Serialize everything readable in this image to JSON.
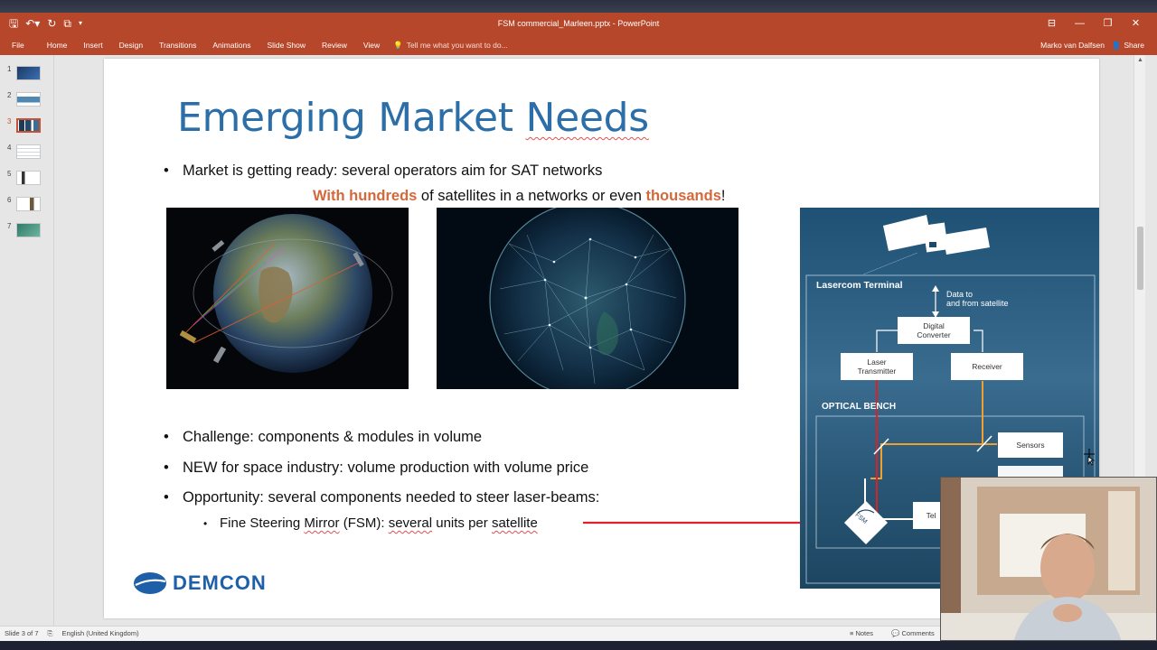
{
  "window": {
    "title": "FSM commercial_Marleen.pptx - PowerPoint",
    "controls": [
      "⊟",
      "—",
      "❐",
      "✕"
    ]
  },
  "ribbon": {
    "tabs": [
      "File",
      "Home",
      "Insert",
      "Design",
      "Transitions",
      "Animations",
      "Slide Show",
      "Review",
      "View"
    ],
    "tell_me": "Tell me what you want to do...",
    "user": "Marko van Dalfsen",
    "share": "Share"
  },
  "thumbnails": [
    "1",
    "2",
    "3",
    "4",
    "5",
    "6",
    "7"
  ],
  "active_slide": 3,
  "slide": {
    "title_part1": "Emerging Market ",
    "title_part2": "Needs",
    "bullet1": "Market is getting ready: several operators aim for SAT networks",
    "highlight": {
      "a": "With hundreds",
      "b": " of satellites in a networks or even ",
      "c": "thousands",
      "d": "!"
    },
    "bullet2": "Challenge: components & modules in volume",
    "bullet3": "NEW for space industry: volume production with volume price",
    "bullet4": "Opportunity: several components needed to steer laser-beams:",
    "sub": {
      "a": "Fine Steering ",
      "b": "Mirror",
      "c": " (FSM): ",
      "d": "several",
      "e": " units per ",
      "f": "satellite"
    },
    "logo": "DEMCON"
  },
  "diagram": {
    "title": "Lasercom Terminal",
    "data_label_1": "Data to",
    "data_label_2": "and from satellite",
    "digital_converter_1": "Digital",
    "digital_converter_2": "Converter",
    "laser_transmitter_1": "Laser",
    "laser_transmitter_2": "Transmitter",
    "receiver": "Receiver",
    "optical_bench": "OPTICAL BENCH",
    "sensors": "Sensors",
    "fsm": "FSM",
    "telescope_partial": "Tel"
  },
  "statusbar": {
    "slide_of": "Slide 3 of 7",
    "language": "English (United Kingdom)",
    "notes": "Notes",
    "comments": "Comments"
  },
  "colors": {
    "accent": "#b7472a",
    "title_blue": "#2c6ea8",
    "highlight_orange": "#d4683a",
    "arrow_red": "#e0202a"
  }
}
